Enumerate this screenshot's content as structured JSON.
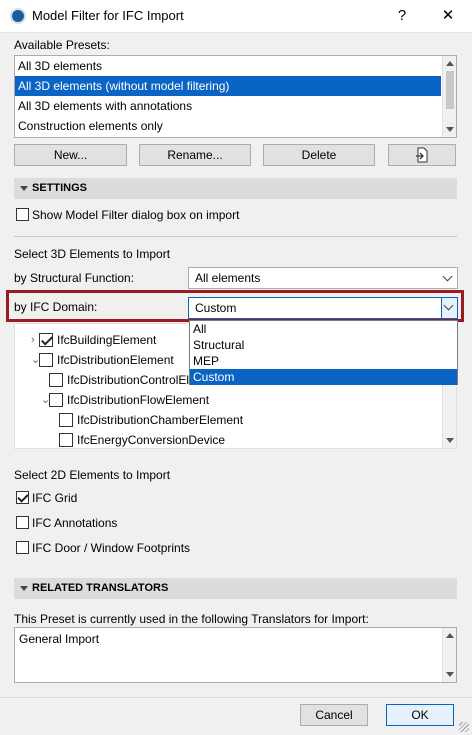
{
  "window": {
    "title": "Model Filter for IFC Import",
    "help_button": "?",
    "close_button": "✕"
  },
  "presets": {
    "label": "Available Presets:",
    "items": [
      "All 3D elements",
      "All 3D elements (without model filtering)",
      "All 3D elements with annotations",
      "Construction elements only"
    ],
    "selected_index": 1,
    "buttons": {
      "new": "New...",
      "rename": "Rename...",
      "delete": "Delete",
      "export_icon": "export-icon"
    }
  },
  "settings": {
    "section_title": "SETTINGS",
    "show_dialog_label": "Show Model Filter dialog box on import",
    "show_dialog_checked": false
  },
  "select3d": {
    "heading": "Select 3D Elements to Import",
    "structural_label": "by Structural Function:",
    "structural_value": "All elements",
    "ifc_domain_label": "by IFC Domain:",
    "ifc_domain_value": "Custom",
    "ifc_domain_options": [
      "All",
      "Structural",
      "MEP",
      "Custom"
    ],
    "ifc_domain_selected_index": 3,
    "tree": [
      {
        "label": "IfcBuildingElement",
        "checked": true,
        "expand": "›"
      },
      {
        "label": "IfcDistributionElement",
        "checked": false,
        "expand": "⌄"
      },
      {
        "label": "IfcDistributionControlElement",
        "checked": false,
        "expand": ""
      },
      {
        "label": "IfcDistributionFlowElement",
        "checked": false,
        "expand": "⌄"
      },
      {
        "label": "IfcDistributionChamberElement",
        "checked": false,
        "expand": ""
      },
      {
        "label": "IfcEnergyConversionDevice",
        "checked": false,
        "expand": ""
      }
    ]
  },
  "select2d": {
    "heading": "Select 2D Elements to Import",
    "items": [
      {
        "label": "IFC Grid",
        "checked": true
      },
      {
        "label": "IFC Annotations",
        "checked": false
      },
      {
        "label": "IFC Door / Window Footprints",
        "checked": false
      }
    ]
  },
  "related": {
    "section_title": "RELATED TRANSLATORS",
    "description": "This Preset is currently used in the following Translators for Import:",
    "translators_text": "General Import"
  },
  "footer": {
    "cancel": "Cancel",
    "ok": "OK"
  },
  "colors": {
    "selection": "#0a64c4",
    "highlight_frame": "#9b1b23"
  }
}
